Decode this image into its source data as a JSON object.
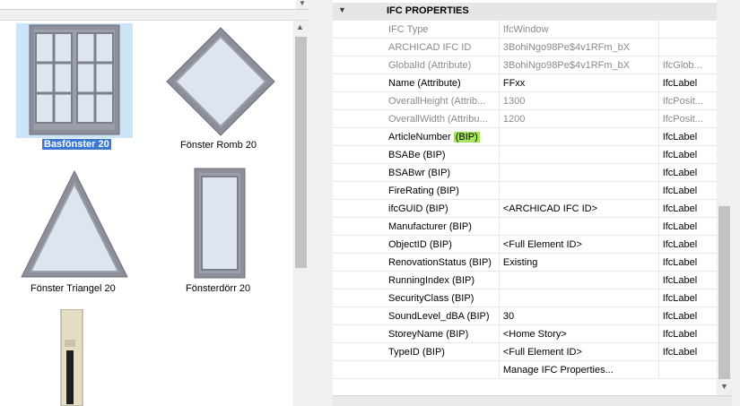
{
  "library": {
    "items": [
      {
        "label": "Basfönster 20",
        "icon": "casement-window-icon",
        "selected": true
      },
      {
        "label": "Fönster Romb 20",
        "icon": "diamond-window-icon"
      },
      {
        "label": "Fönster Triangel 20",
        "icon": "triangle-window-icon"
      },
      {
        "label": "Fönsterdörr 20",
        "icon": "french-window-door-icon"
      },
      {
        "label": "",
        "icon": "narrow-window-icon"
      }
    ]
  },
  "panel": {
    "section_title": "IFC PROPERTIES",
    "rows": [
      {
        "name": "IFC Type",
        "value": "IfcWindow",
        "type": "",
        "style": "grey"
      },
      {
        "name": "ARCHICAD IFC ID",
        "value": "3BohiNgo98Pe$4v1RFm_bX",
        "type": "",
        "style": "grey"
      },
      {
        "name": "GlobalId (Attribute)",
        "value": "3BohiNgo98Pe$4v1RFm_bX",
        "type": "IfcGlob...",
        "style": "grey"
      },
      {
        "name": "Name (Attribute)",
        "value": "FFxx",
        "type": "IfcLabel",
        "style": "black"
      },
      {
        "name": "OverallHeight (Attrib...",
        "value": "1300",
        "type": "IfcPosit...",
        "style": "grey"
      },
      {
        "name": "OverallWidth (Attribu...",
        "value": "1200",
        "type": "IfcPosit...",
        "style": "grey"
      },
      {
        "name": "ArticleNumber",
        "name_suffix": "(BIP)",
        "value": "",
        "type": "IfcLabel",
        "style": "black"
      },
      {
        "name": "BSABe (BIP)",
        "value": "",
        "type": "IfcLabel",
        "style": "black"
      },
      {
        "name": "BSABwr (BIP)",
        "value": "",
        "type": "IfcLabel",
        "style": "black"
      },
      {
        "name": "FireRating (BIP)",
        "value": "",
        "type": "IfcLabel",
        "style": "black"
      },
      {
        "name": "ifcGUID (BIP)",
        "value": "<ARCHICAD IFC ID>",
        "type": "IfcLabel",
        "style": "black"
      },
      {
        "name": "Manufacturer (BIP)",
        "value": "",
        "type": "IfcLabel",
        "style": "black"
      },
      {
        "name": "ObjectID (BIP)",
        "value": "<Full Element ID>",
        "type": "IfcLabel",
        "style": "black"
      },
      {
        "name": "RenovationStatus (BIP)",
        "value": "Existing",
        "type": "IfcLabel",
        "style": "black"
      },
      {
        "name": "RunningIndex (BIP)",
        "value": "",
        "type": "IfcLabel",
        "style": "black"
      },
      {
        "name": "SecurityClass (BIP)",
        "value": "",
        "type": "IfcLabel",
        "style": "black"
      },
      {
        "name": "SoundLevel_dBA (BIP)",
        "value": "30",
        "type": "IfcLabel",
        "style": "black"
      },
      {
        "name": "StoreyName (BIP)",
        "value": "<Home Story>",
        "type": "IfcLabel",
        "style": "black"
      },
      {
        "name": "TypeID (BIP)",
        "value": "<Full Element ID>",
        "type": "IfcLabel",
        "style": "black"
      },
      {
        "name": "",
        "value": "Manage IFC Properties...",
        "type": "",
        "style": "black"
      }
    ]
  },
  "colors": {
    "selection": "#cce4f7",
    "selected_label_bg": "#3b78d6",
    "bip_highlight": "#a6e65e",
    "frame": "#8c8f99",
    "glass": "#dde6ee"
  },
  "icons": {
    "section_collapse": "collapse-triangle-icon",
    "scroll_up": "chevron-up-icon",
    "scroll_down": "chevron-down-icon"
  }
}
